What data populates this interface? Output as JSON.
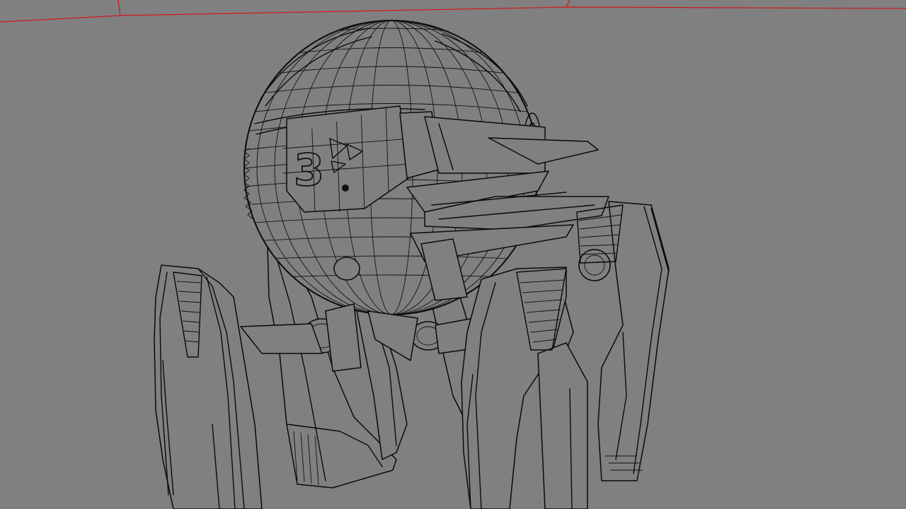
{
  "viewport": {
    "background_color": "#808080",
    "wire_color": "#0a0a0a",
    "guide_line_color": "#d01818",
    "head_decal": "3"
  }
}
